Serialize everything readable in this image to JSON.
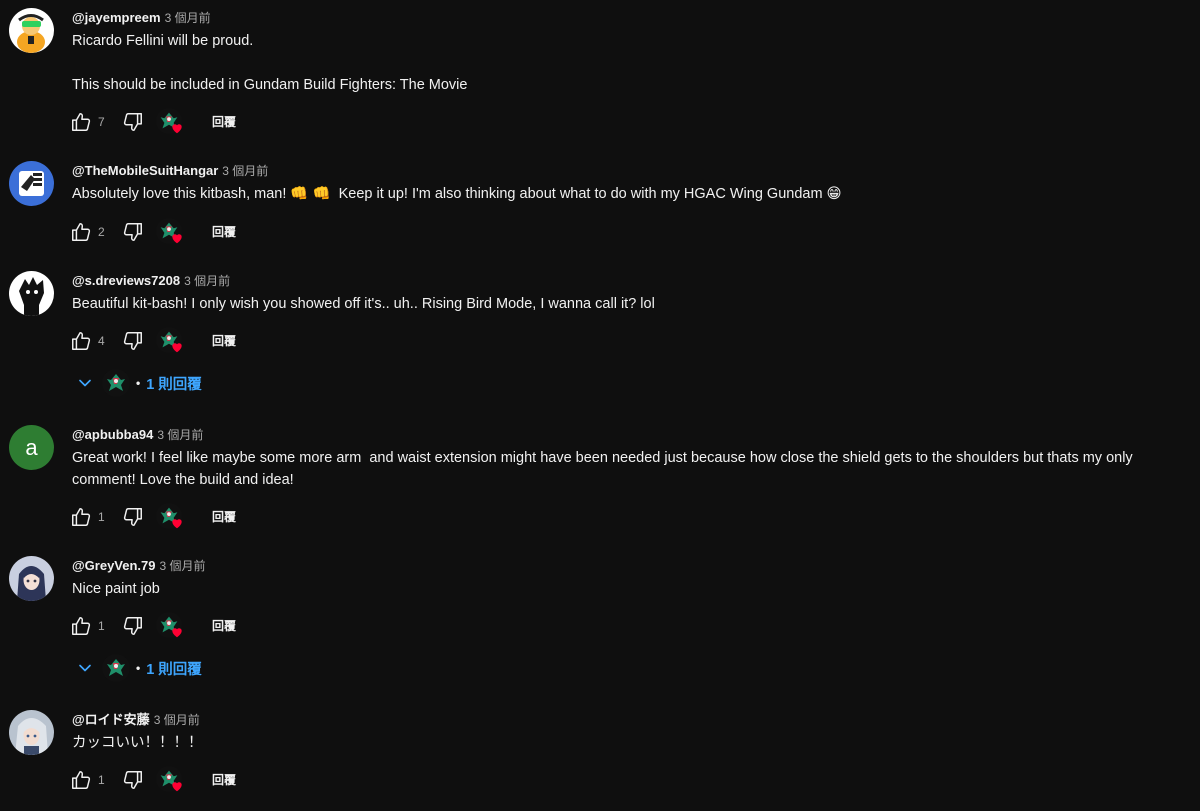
{
  "comments": [
    {
      "author": "@jayempreem",
      "time": "3 個月前",
      "text": "Ricardo Fellini will be proud.\n\nThis should be included in Gundam Build Fighters: The Movie",
      "likes": "7",
      "reply_label": "回覆"
    },
    {
      "author": "@TheMobileSuitHangar",
      "time": "3 個月前",
      "text": "Absolutely love this kitbash, man! 👊 👊  Keep it up! I'm also thinking about what to do with my HGAC Wing Gundam 😁",
      "likes": "2",
      "reply_label": "回覆"
    },
    {
      "author": "@s.dreviews7208",
      "time": "3 個月前",
      "text": "Beautiful kit-bash! I only wish you showed off it's.. uh.. Rising Bird Mode, I wanna call it? lol",
      "likes": "4",
      "reply_label": "回覆",
      "replies": "1 則回覆"
    },
    {
      "author": "@apbubba94",
      "time": "3 個月前",
      "text": "Great work! I feel like maybe some more arm  and waist extension might have been needed just because how close the shield gets to the shoulders but thats my only comment! Love the build and idea!",
      "likes": "1",
      "reply_label": "回覆",
      "avatar_letter": "a"
    },
    {
      "author": "@GreyVen.79",
      "time": "3 個月前",
      "text": "Nice paint job",
      "likes": "1",
      "reply_label": "回覆",
      "replies": "1 則回覆"
    },
    {
      "author": "@ロイド安藤",
      "time": "3 個月前",
      "text": "カッコいい！！！！",
      "likes": "1",
      "reply_label": "回覆"
    }
  ],
  "colors": {
    "background": "#0f0f0f",
    "text": "#f1f1f1",
    "secondary": "#aaaaaa",
    "link": "#3ea6ff",
    "heart": "#ff0033",
    "avatar_green": "#2e7d32"
  },
  "icons": {
    "like": "thumb-up-icon",
    "dislike": "thumb-down-icon",
    "creator_heart": "creator-heart-icon",
    "expand": "chevron-down-icon"
  }
}
